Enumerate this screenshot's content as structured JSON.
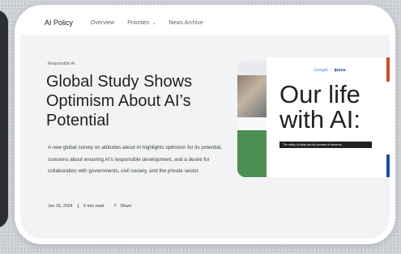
{
  "nav": {
    "brand": "AI Policy",
    "links": [
      "Overview",
      "Priorities",
      "News Archive"
    ]
  },
  "article": {
    "tag": "Responsible AI",
    "title": "Global Study Shows Optimism About AI’s Potential",
    "description": "A new global survey on attitudes about AI highlights optimism for its potential, concerns about ensuring AI’s responsible development, and a desire for collaboration with governments, civil society, and the private sector.",
    "date": "Jan 15, 2024",
    "read_time": "6 min read",
    "share_label": "Share"
  },
  "hero": {
    "logo_left": "Google",
    "logo_right": "Ipsos",
    "headline": "Our life with AI:",
    "banner": "The reality of today and the promise of tomorrow"
  },
  "colors": {
    "accent_green": "#4d8f52",
    "accent_orange": "#c5522e",
    "accent_blue": "#1f4e9b"
  }
}
